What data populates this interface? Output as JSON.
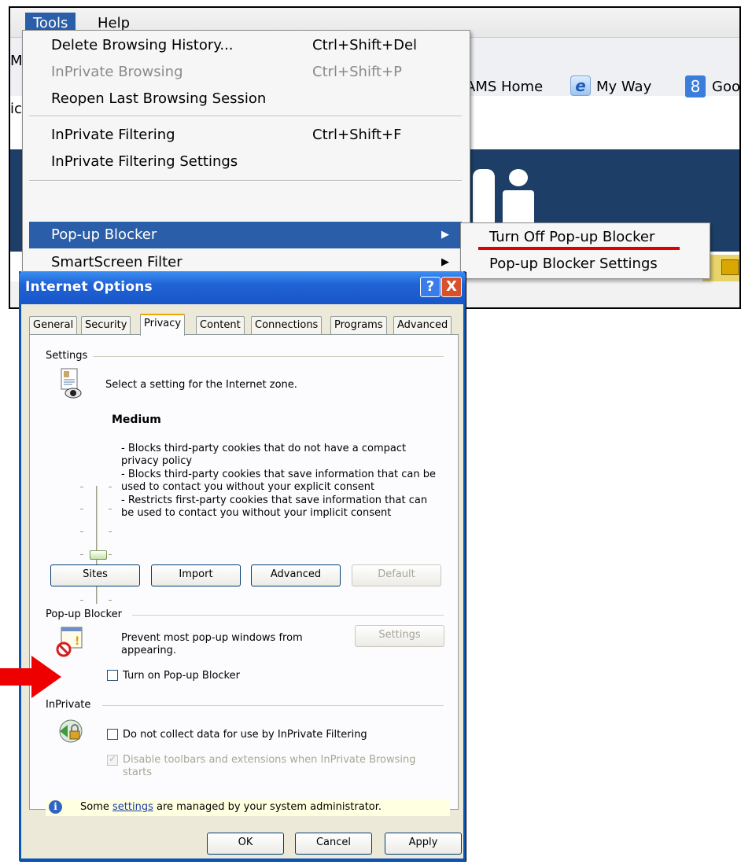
{
  "browser": {
    "menu_tools": "Tools",
    "menu_help": "Help",
    "fav_partial_m": "M",
    "fav_partial_c": "ic",
    "fav_ams": "AMS Home",
    "fav_myway": "My Way",
    "fav_goo": "Goo",
    "fav_g8_glyph": "8"
  },
  "tools_menu": {
    "items": [
      {
        "label": "Delete Browsing History...",
        "shortcut": "Ctrl+Shift+Del"
      },
      {
        "label": "InPrivate Browsing",
        "shortcut": "Ctrl+Shift+P"
      },
      {
        "label": "Reopen Last Browsing Session",
        "shortcut": ""
      },
      {
        "label": "InPrivate Filtering",
        "shortcut": "Ctrl+Shift+F"
      },
      {
        "label": "InPrivate Filtering Settings",
        "shortcut": ""
      },
      {
        "label": "Pop-up Blocker",
        "shortcut": ""
      },
      {
        "label": "SmartScreen Filter",
        "shortcut": ""
      }
    ]
  },
  "submenu": {
    "items": [
      "Turn Off Pop-up Blocker",
      "Pop-up Blocker Settings"
    ]
  },
  "dialog": {
    "title": "Internet Options",
    "help_glyph": "?",
    "close_glyph": "X",
    "tabs": [
      "General",
      "Security",
      "Privacy",
      "Content",
      "Connections",
      "Programs",
      "Advanced"
    ],
    "settings": {
      "group": "Settings",
      "description": "Select a setting for the Internet zone.",
      "level": "Medium",
      "bullet1": "- Blocks third-party cookies that do not have a compact privacy policy",
      "bullet2": "- Blocks third-party cookies that save information that can be used to contact you without your explicit consent",
      "bullet3": "- Restricts first-party cookies that save information that can be used to contact you without your implicit consent",
      "buttons": [
        "Sites",
        "Import",
        "Advanced",
        "Default"
      ]
    },
    "popup": {
      "group": "Pop-up Blocker",
      "description": "Prevent most pop-up windows from appearing.",
      "settings_button": "Settings",
      "checkbox": "Turn on Pop-up Blocker"
    },
    "inprivate": {
      "group": "InPrivate",
      "checkbox1": "Do not collect data for use by InPrivate Filtering",
      "checkbox2": "Disable toolbars and extensions when InPrivate Browsing starts"
    },
    "info": {
      "before": "Some ",
      "link": "settings",
      "after": " are managed by your system administrator."
    },
    "footer": [
      "OK",
      "Cancel",
      "Apply"
    ]
  },
  "colors": {
    "menu_highlight": "#2b5ea8",
    "annotation_red": "#e00000",
    "dialog_face": "#ece9d8",
    "titlebar_blue": "#1f63d6"
  }
}
